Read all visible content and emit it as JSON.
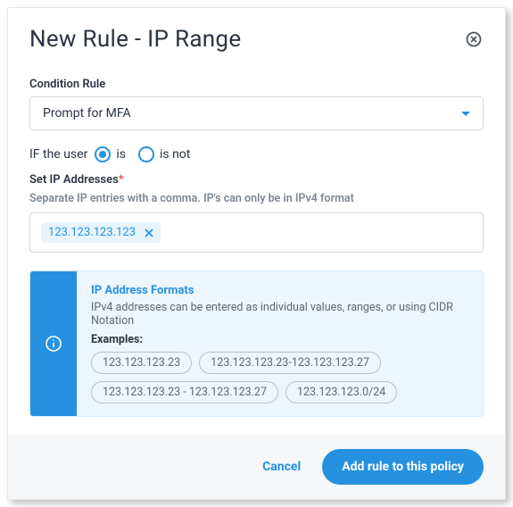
{
  "header": {
    "title": "New Rule - IP Range"
  },
  "condition": {
    "label": "Condition Rule",
    "selected": "Prompt for MFA"
  },
  "userCondition": {
    "prefix": "IF the user",
    "options": {
      "is": "is",
      "isNot": "is not"
    }
  },
  "ipField": {
    "label": "Set IP Addresses",
    "hint": "Separate IP entries with a comma. IP's can only be in IPv4 format",
    "chips": [
      "123.123.123.123"
    ]
  },
  "info": {
    "title": "IP Address Formats",
    "description": "IPv4 addresses can be entered as individual values, ranges, or using CIDR Notation",
    "examplesLabel": "Examples:",
    "examples": [
      "123.123.123.23",
      "123.123.123.23-123.123.123.27",
      "123.123.123.23 - 123.123.123.27",
      "123.123.123.0/24"
    ]
  },
  "footer": {
    "cancel": "Cancel",
    "primary": "Add rule to this policy"
  }
}
